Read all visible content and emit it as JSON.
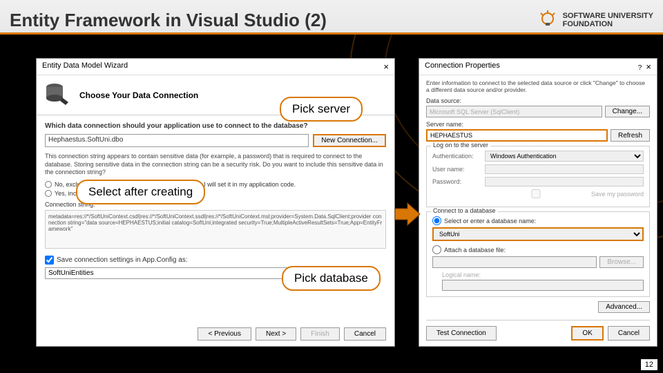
{
  "header": {
    "title": "Entity Framework in Visual Studio (2)",
    "logo_line1": "SOFTWARE UNIVERSITY",
    "logo_line2": "FOUNDATION"
  },
  "wizard": {
    "window_title": "Entity Data Model Wizard",
    "banner_title": "Choose Your Data Connection",
    "question": "Which data connection should your application use to connect to the database?",
    "conn_value": "Hephaestus.SoftUni.dbo",
    "new_conn_btn": "New Connection...",
    "warning": "This connection string appears to contain sensitive data (for example, a password) that is required to connect to the database. Storing sensitive data in the connection string can be a security risk. Do you want to include this sensitive data in the connection string?",
    "radio1": "No, exclude sensitive data from the connection string. I will set it in my application code.",
    "radio2": "Yes, include the sensitive data in the connection string.",
    "cs_label": "Connection string:",
    "cs_value": "metadata=res://*/SoftUniContext.csdl|res://*/SoftUniContext.ssdl|res://*/SoftUniContext.msl;provider=System.Data.SqlClient;provider connection string=\"data source=HEPHAESTUS;initial catalog=SoftUni;integrated security=True;MultipleActiveResultSets=True;App=EntityFramework\"",
    "save_label": "Save connection settings in App.Config as:",
    "save_value": "SoftUniEntities",
    "btn_prev": "< Previous",
    "btn_next": "Next >",
    "btn_finish": "Finish",
    "btn_cancel": "Cancel"
  },
  "props": {
    "window_title": "Connection Properties",
    "intro": "Enter information to connect to the selected data source or click \"Change\" to choose a different data source and/or provider.",
    "ds_label": "Data source:",
    "ds_value": "Microsoft SQL Server (SqlClient)",
    "change_btn": "Change...",
    "server_label": "Server name:",
    "server_value": "HEPHAESTUS",
    "refresh_btn": "Refresh",
    "logon_title": "Log on to the server",
    "auth_label": "Authentication:",
    "auth_value": "Windows Authentication",
    "user_label": "User name:",
    "pwd_label": "Password:",
    "save_pwd": "Save my password",
    "connect_title": "Connect to a database",
    "radio_select": "Select or enter a database name:",
    "db_value": "SoftUni",
    "radio_attach": "Attach a database file:",
    "browse_btn": "Browse...",
    "logical_label": "Logical name:",
    "advanced_btn": "Advanced...",
    "test_btn": "Test Connection",
    "ok_btn": "OK",
    "cancel_btn": "Cancel"
  },
  "callouts": {
    "server": "Pick server",
    "create": "Select after creating",
    "db": "Pick database"
  },
  "page_num": "12"
}
